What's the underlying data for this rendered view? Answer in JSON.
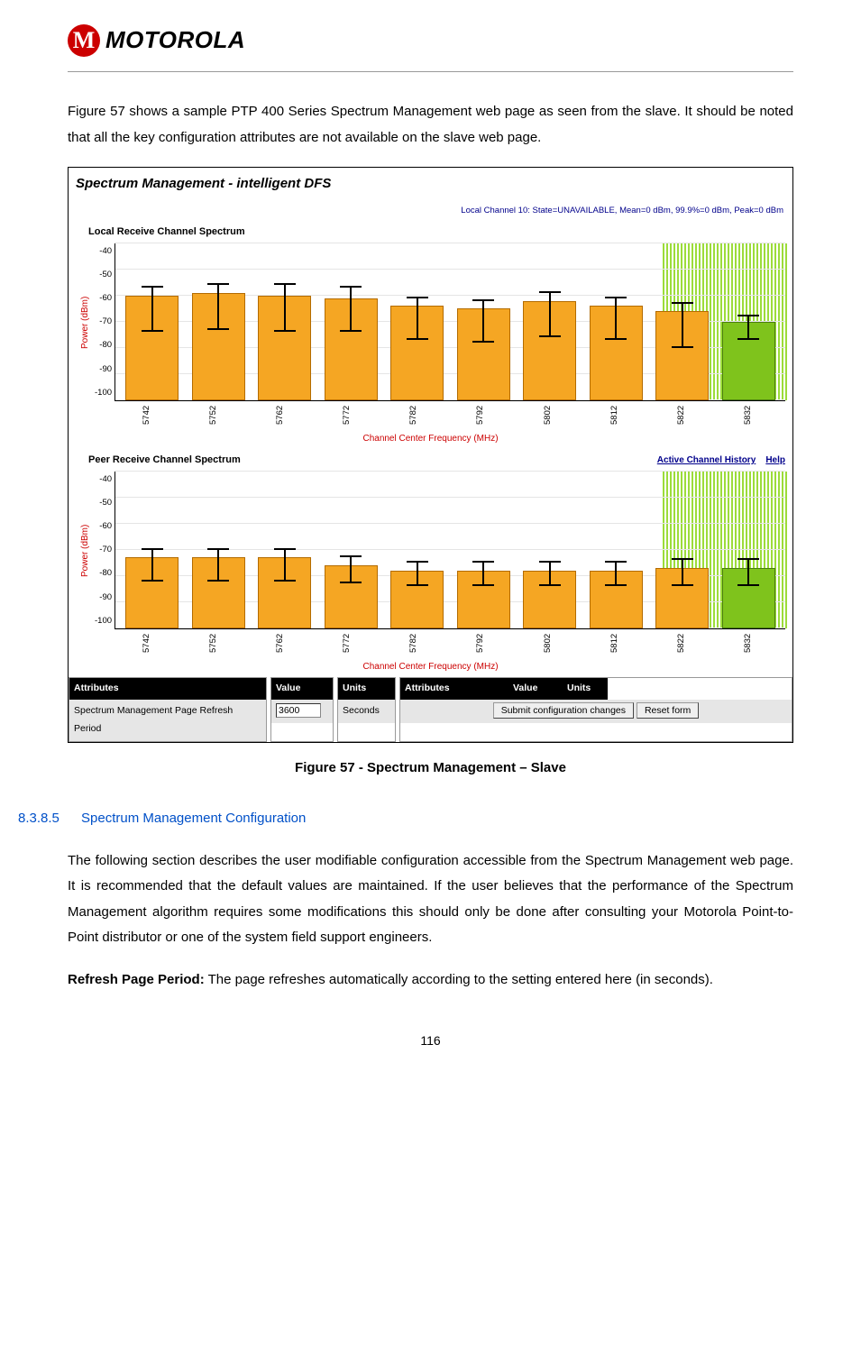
{
  "header": {
    "brand": "MOTOROLA"
  },
  "intro_para": "Figure 57 shows a sample PTP 400 Series Spectrum Management web page as seen from the slave. It should be noted that all the key configuration attributes are not available on the slave web page.",
  "figure": {
    "title": "Spectrum Management - intelligent DFS",
    "status": "Local Channel 10: State=UNAVAILABLE, Mean=0 dBm, 99.9%=0 dBm, Peak=0 dBm",
    "caption": "Figure 57 - Spectrum Management – Slave",
    "x_label": "Channel Center Frequency (MHz)",
    "y_label": "Power (dBm)",
    "links": {
      "history": "Active Channel History",
      "help": "Help"
    },
    "local_title": "Local Receive Channel Spectrum",
    "peer_title": "Peer Receive Channel Spectrum",
    "attr_header": "Attributes",
    "value_header": "Value",
    "units_header": "Units",
    "refresh_attr": "Spectrum Management Page Refresh Period",
    "refresh_value": "3600",
    "refresh_units": "Seconds",
    "submit_label": "Submit configuration changes",
    "reset_label": "Reset form"
  },
  "chart_data": [
    {
      "type": "bar",
      "title": "Local Receive Channel Spectrum",
      "ylabel": "Power (dBm)",
      "xlabel": "Channel Center Frequency (MHz)",
      "ylim": [
        -100,
        -40
      ],
      "categories": [
        "5742",
        "5752",
        "5762",
        "5772",
        "5782",
        "5792",
        "5802",
        "5812",
        "5822",
        "5832"
      ],
      "series": [
        {
          "name": "Mean",
          "values": [
            -60,
            -59,
            -60,
            -61,
            -64,
            -65,
            -62,
            -64,
            -66,
            -70
          ]
        },
        {
          "name": "99.9%",
          "values": [
            -57,
            -56,
            -56,
            -57,
            -61,
            -62,
            -59,
            -61,
            -63,
            -68
          ]
        },
        {
          "name": "Peak",
          "values": [
            -74,
            -73,
            -74,
            -74,
            -77,
            -78,
            -76,
            -77,
            -80,
            -77
          ]
        }
      ],
      "highlight_index": 9
    },
    {
      "type": "bar",
      "title": "Peer Receive Channel Spectrum",
      "ylabel": "Power (dBm)",
      "xlabel": "Channel Center Frequency (MHz)",
      "ylim": [
        -100,
        -40
      ],
      "categories": [
        "5742",
        "5752",
        "5762",
        "5772",
        "5782",
        "5792",
        "5802",
        "5812",
        "5822",
        "5832"
      ],
      "series": [
        {
          "name": "Mean",
          "values": [
            -73,
            -73,
            -73,
            -76,
            -78,
            -78,
            -78,
            -78,
            -77,
            -77
          ]
        },
        {
          "name": "99.9%",
          "values": [
            -70,
            -70,
            -70,
            -73,
            -75,
            -75,
            -75,
            -75,
            -74,
            -74
          ]
        },
        {
          "name": "Peak",
          "values": [
            -82,
            -82,
            -82,
            -83,
            -84,
            -84,
            -84,
            -84,
            -84,
            -84
          ]
        }
      ],
      "highlight_index": 9
    }
  ],
  "section": {
    "number": "8.3.8.5",
    "title": "Spectrum Management Configuration",
    "para1": "The following section describes the user modifiable configuration accessible from the Spectrum Management web page. It is recommended that the default values are maintained. If the user believes that the performance of the Spectrum Management algorithm requires some modifications this should only be done after consulting your Motorola Point-to-Point distributor or one of the system field support engineers.",
    "para2_label": "Refresh Page Period:",
    "para2_rest": " The page refreshes automatically according to the setting entered here (in seconds)."
  },
  "page_number": "116",
  "y_ticks": [
    "-40",
    "-50",
    "-60",
    "-70",
    "-80",
    "-90",
    "-100"
  ]
}
